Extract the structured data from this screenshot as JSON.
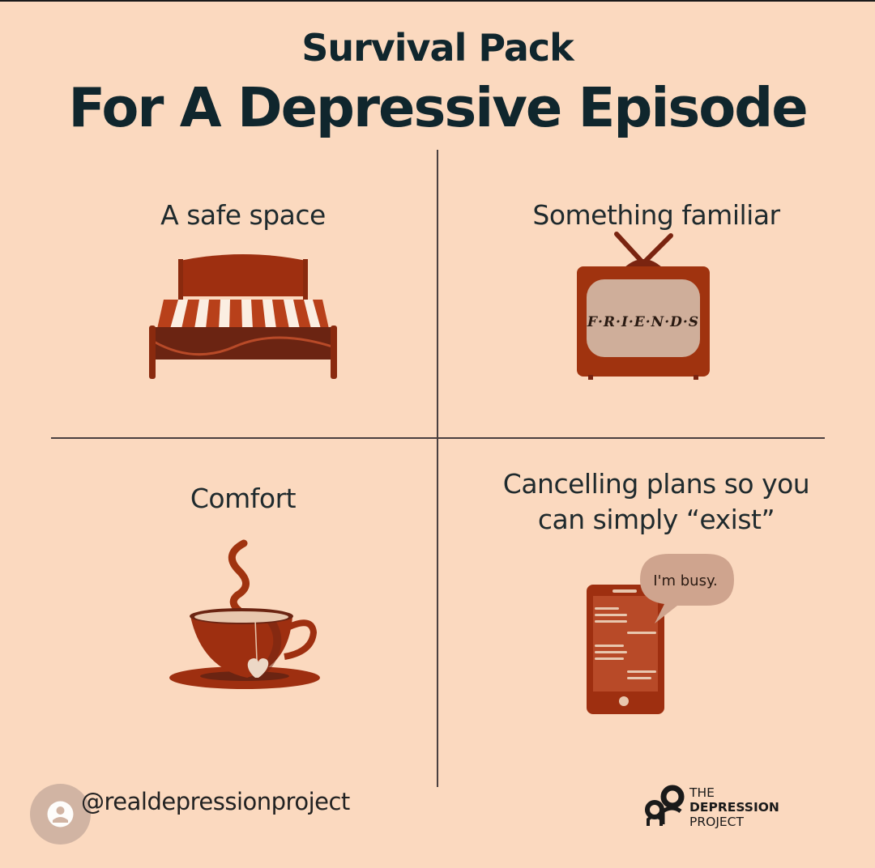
{
  "header": {
    "subtitle": "Survival Pack",
    "title": "For A Depressive Episode"
  },
  "quadrants": [
    {
      "label": "A safe space",
      "icon": "bed-icon"
    },
    {
      "label": "Something familiar",
      "icon": "tv-icon",
      "screen_text": "F·R·I·E·N·D·S"
    },
    {
      "label": "Comfort",
      "icon": "tea-cup-icon"
    },
    {
      "label_line1": "Cancelling plans so you",
      "label_line2": "can simply “exist”",
      "icon": "phone-icon",
      "bubble_text": "I'm busy."
    }
  ],
  "footer": {
    "handle": "@realdepressionproject",
    "logo_line1": "THE",
    "logo_line2": "DEPRESSION",
    "logo_line3": "PROJECT"
  },
  "colors": {
    "background": "#fbd9bf",
    "title": "#10262d",
    "accent_red": "#9e2f10",
    "accent_dark": "#7a2410"
  }
}
